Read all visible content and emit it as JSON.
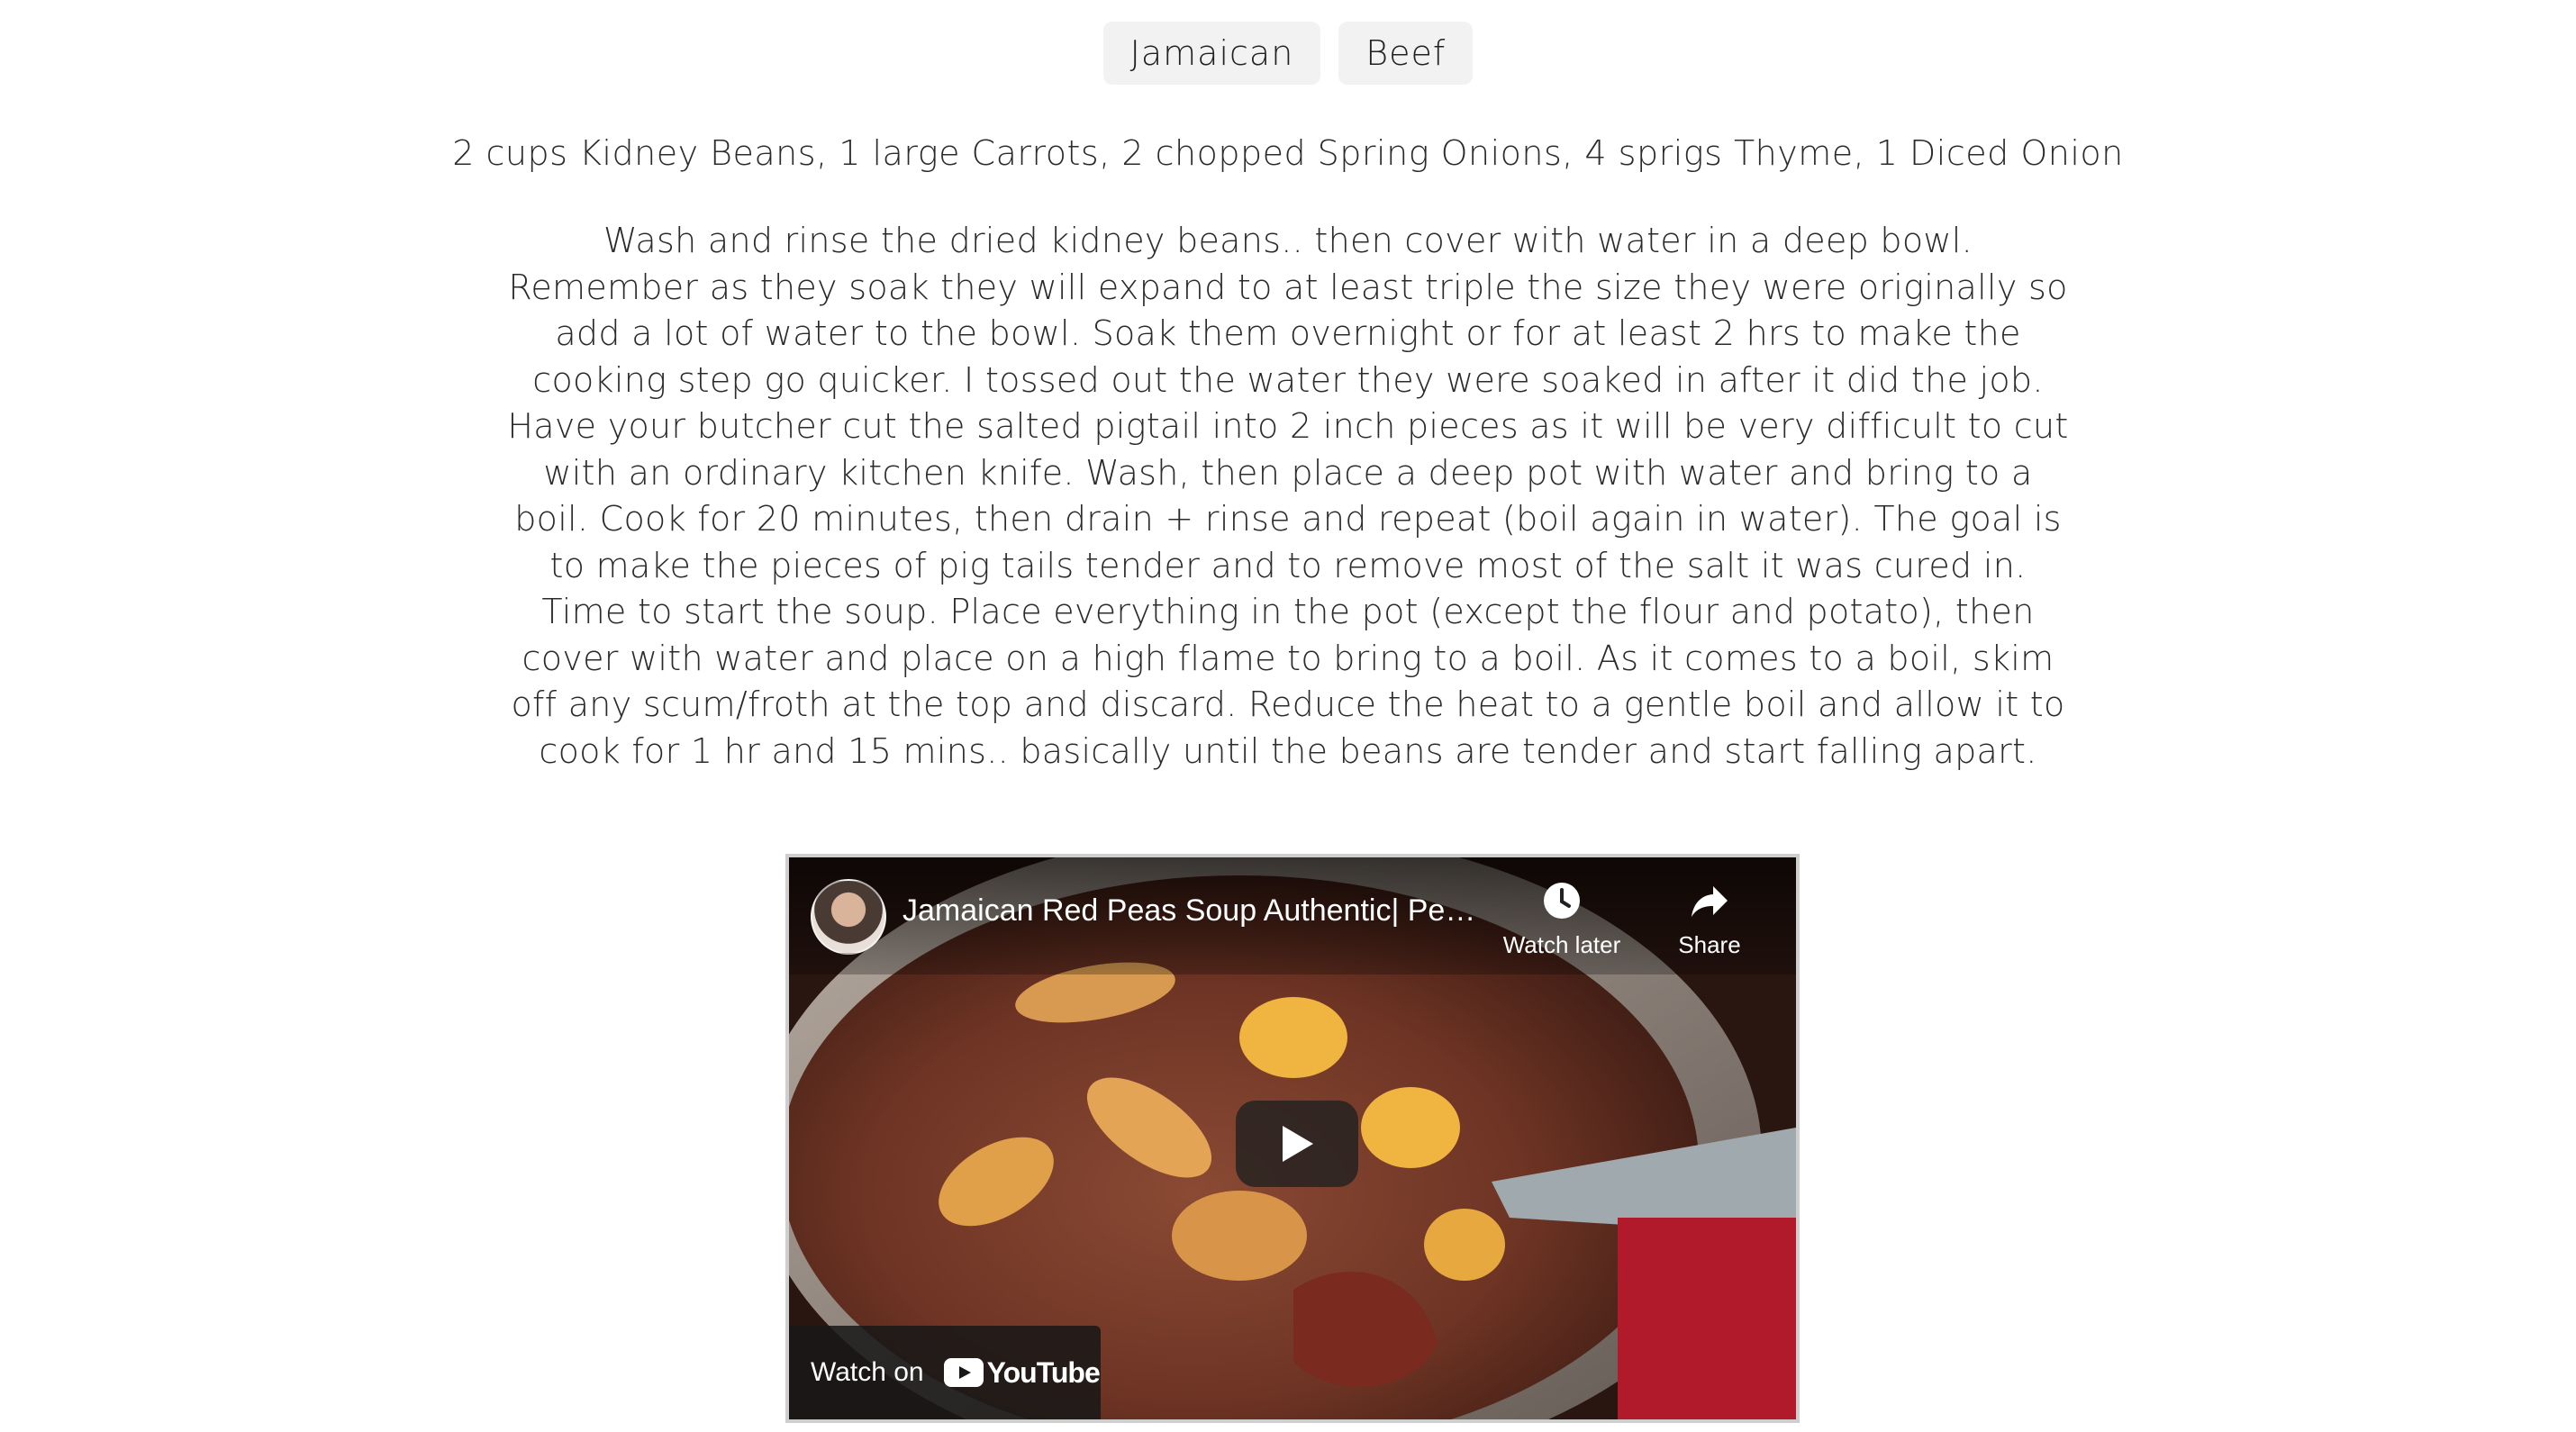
{
  "tags": [
    "Jamaican",
    "Beef"
  ],
  "ingredients": "2 cups Kidney Beans, 1 large Carrots, 2 chopped Spring Onions, 4 sprigs Thyme, 1 Diced Onion",
  "instructions": "Wash and rinse the dried kidney beans.. then cover with water in a deep bowl. Remember as they soak they will expand to at least triple the size they were originally so add a lot of water to the bowl. Soak them overnight or for at least 2 hrs to make the cooking step go quicker. I tossed out the water they were soaked in after it did the job. Have your butcher cut the salted pigtail into 2 inch pieces as it will be very difficult to cut with an ordinary kitchen knife. Wash, then place a deep pot with water and bring to a boil. Cook for 20 minutes, then drain + rinse and repeat (boil again in water). The goal is to make the pieces of pig tails tender and to remove most of the salt it was cured in. Time to start the soup. Place everything in the pot (except the flour and potato), then cover with water and place on a high flame to bring to a boil. As it comes to a boil, skim off any scum/froth at the top and discard. Reduce the heat to a gentle boil and allow it to cook for 1 hr and 15 mins.. basically until the beans are tender and start falling apart.",
  "video": {
    "title": "Jamaican Red Peas Soup Authentic| Pe…",
    "watch_later_label": "Watch later",
    "share_label": "Share",
    "watch_on_label": "Watch on",
    "youtube_label": "YouTube"
  },
  "icons": {
    "play": "play-icon",
    "clock": "clock-icon",
    "share": "share-icon",
    "youtube": "youtube-logo"
  },
  "colors": {
    "tag_background": "#f2f2f2",
    "text": "#2b2b2b",
    "video_border": "#cfcfcf"
  }
}
